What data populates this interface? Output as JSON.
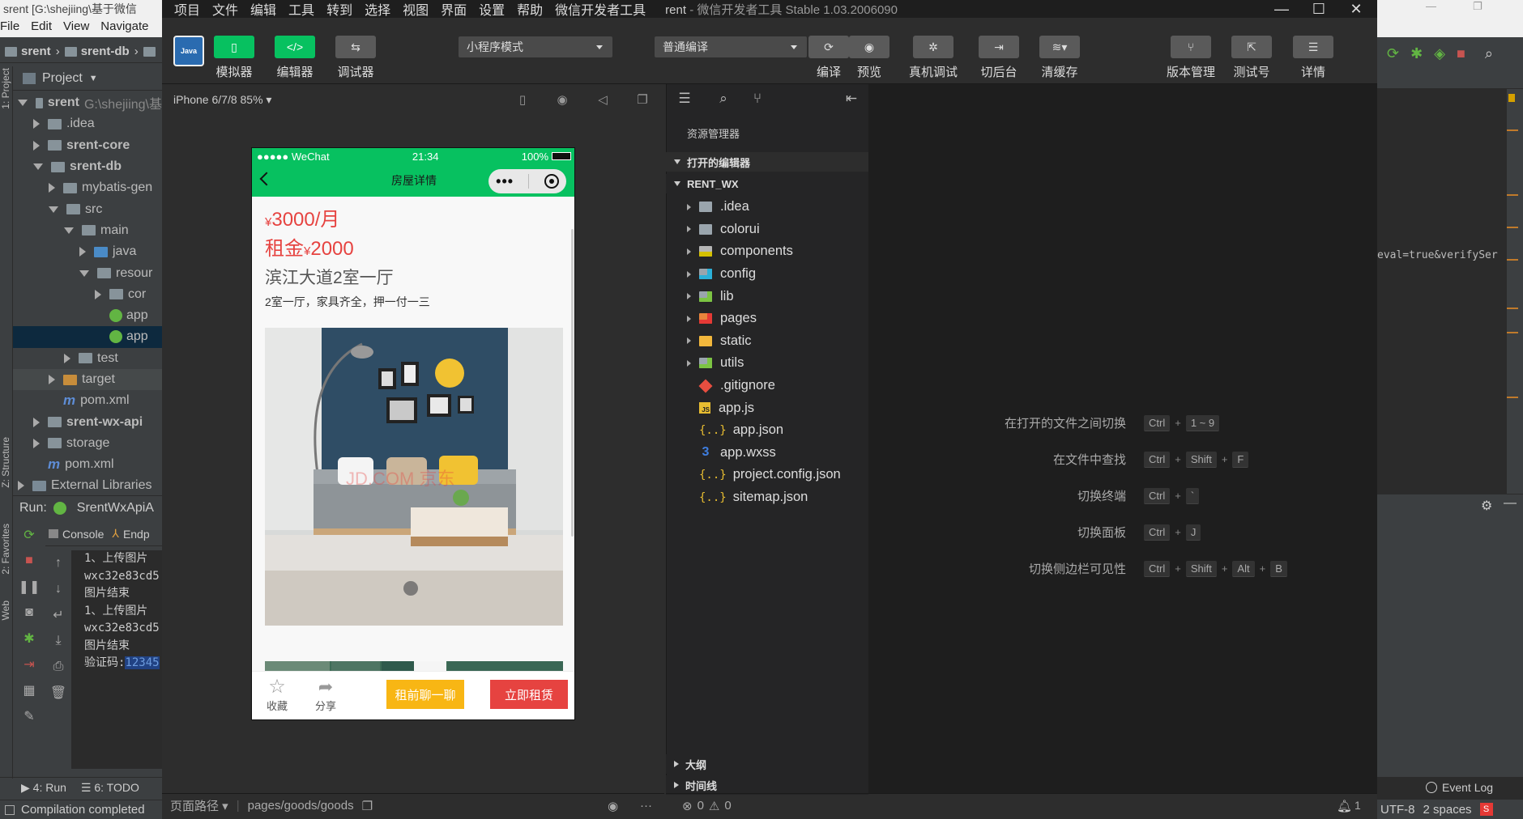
{
  "ij": {
    "title": "srent [G:\\shejiing\\基于微信",
    "menu": [
      "File",
      "Edit",
      "View",
      "Navigate"
    ],
    "breadcrumb": [
      "srent",
      "srent-db"
    ],
    "project_label": "Project",
    "sidebar_tab_project": "1: Project",
    "sidebar_tab_structure": "Z: Structure",
    "sidebar_tab_favorites": "2: Favorites",
    "sidebar_tab_web": "Web",
    "tree": [
      {
        "label": "srent",
        "suffix": "G:\\shejiing\\基",
        "depth": 0,
        "open": true,
        "icon": "folder",
        "bold": true
      },
      {
        "label": ".idea",
        "depth": 1,
        "open": false,
        "icon": "folder"
      },
      {
        "label": "srent-core",
        "depth": 1,
        "open": false,
        "icon": "folder",
        "bold": true
      },
      {
        "label": "srent-db",
        "depth": 1,
        "open": true,
        "icon": "folder",
        "bold": true
      },
      {
        "label": "mybatis-gen",
        "depth": 2,
        "open": false,
        "icon": "folder"
      },
      {
        "label": "src",
        "depth": 2,
        "open": true,
        "icon": "folder"
      },
      {
        "label": "main",
        "depth": 3,
        "open": true,
        "icon": "folder"
      },
      {
        "label": "java",
        "depth": 4,
        "open": false,
        "icon": "folder-blue"
      },
      {
        "label": "resour",
        "depth": 4,
        "open": true,
        "icon": "folder"
      },
      {
        "label": "cor",
        "depth": 5,
        "open": false,
        "icon": "folder"
      },
      {
        "label": "app",
        "depth": 5,
        "icon": "leaf"
      },
      {
        "label": "app",
        "depth": 5,
        "icon": "leaf",
        "selected": true
      },
      {
        "label": "test",
        "depth": 3,
        "open": false,
        "icon": "folder"
      },
      {
        "label": "target",
        "depth": 2,
        "open": false,
        "icon": "folder-orange",
        "highlight": true
      },
      {
        "label": "pom.xml",
        "depth": 2,
        "icon": "m"
      },
      {
        "label": "srent-wx-api",
        "depth": 1,
        "open": false,
        "icon": "folder",
        "bold": true
      },
      {
        "label": "storage",
        "depth": 1,
        "open": false,
        "icon": "folder"
      },
      {
        "label": "pom.xml",
        "depth": 1,
        "icon": "m"
      },
      {
        "label": "External Libraries",
        "depth": 0,
        "open": false,
        "icon": "lib"
      }
    ],
    "run_label": "Run:",
    "run_config": "SrentWxApiA",
    "run_tabs": [
      "Console",
      "Endp"
    ],
    "console": [
      "1、上传图片",
      "wxc32e83cd5",
      "图片结束",
      "1、上传图片",
      "wxc32e83cd5",
      "图片结束"
    ],
    "console_code_label": "验证码:",
    "console_code_value": "12345",
    "bottom_tabs": [
      "4: Run",
      "6: TODO"
    ],
    "status": "Compilation completed",
    "right_code": "eval=true&verifySer",
    "event_log": "Event Log",
    "encoding": "UTF-8",
    "indent": "2 spaces"
  },
  "wx": {
    "menu": [
      "项目",
      "文件",
      "编辑",
      "工具",
      "转到",
      "选择",
      "视图",
      "界面",
      "设置",
      "帮助",
      "微信开发者工具"
    ],
    "title_project": "rent",
    "title_rest": "- 微信开发者工具 Stable 1.03.2006090",
    "toolbar": {
      "simulator": "模拟器",
      "editor": "编辑器",
      "debugger": "调试器",
      "mode_select": "小程序模式",
      "compile_select": "普通编译",
      "compile": "编译",
      "preview": "预览",
      "real_debug": "真机调试",
      "background": "切后台",
      "clear_cache": "清缓存",
      "version": "版本管理",
      "test_account": "测试号",
      "details": "详情"
    },
    "device": "iPhone 6/7/8 85%",
    "phone": {
      "carrier": "●●●●● WeChat",
      "time": "21:34",
      "battery": "100%",
      "nav_title": "房屋详情",
      "price_symbol": "¥",
      "price": "3000/月",
      "deposit_label": "租金",
      "deposit_symbol": "¥",
      "deposit": "2000",
      "title": "滨江大道2室一厅",
      "desc": "2室一厅，家具齐全，押一付一三",
      "watermark": "JD.COM 京东",
      "fav": "收藏",
      "share": "分享",
      "chat": "租前聊一聊",
      "rent": "立即租赁"
    },
    "page_path_label": "页面路径",
    "page_path": "pages/goods/goods",
    "explorer": {
      "title": "资源管理器",
      "open_editors": "打开的编辑器",
      "project": "RENT_WX",
      "files": [
        {
          "name": ".idea",
          "type": "folder",
          "icon": "gray"
        },
        {
          "name": "colorui",
          "type": "folder",
          "icon": "gray"
        },
        {
          "name": "components",
          "type": "folder",
          "icon": "comp"
        },
        {
          "name": "config",
          "type": "folder",
          "icon": "cfg"
        },
        {
          "name": "lib",
          "type": "folder",
          "icon": "lib"
        },
        {
          "name": "pages",
          "type": "folder",
          "icon": "pages"
        },
        {
          "name": "static",
          "type": "folder",
          "icon": "static"
        },
        {
          "name": "utils",
          "type": "folder",
          "icon": "utils"
        },
        {
          "name": ".gitignore",
          "type": "file",
          "icon": "git"
        },
        {
          "name": "app.js",
          "type": "file",
          "icon": "js"
        },
        {
          "name": "app.json",
          "type": "file",
          "icon": "json"
        },
        {
          "name": "app.wxss",
          "type": "file",
          "icon": "css"
        },
        {
          "name": "project.config.json",
          "type": "file",
          "icon": "json"
        },
        {
          "name": "sitemap.json",
          "type": "file",
          "icon": "json"
        }
      ],
      "outline": "大纲",
      "timeline": "时间线",
      "errors": "0",
      "warnings": "0"
    },
    "shortcuts": [
      {
        "label": "在打开的文件之间切换",
        "keys": [
          "Ctrl",
          "1 ~ 9"
        ]
      },
      {
        "label": "在文件中查找",
        "keys": [
          "Ctrl",
          "Shift",
          "F"
        ]
      },
      {
        "label": "切换终端",
        "keys": [
          "Ctrl",
          "`"
        ]
      },
      {
        "label": "切换面板",
        "keys": [
          "Ctrl",
          "J"
        ]
      },
      {
        "label": "切换侧边栏可见性",
        "keys": [
          "Ctrl",
          "Shift",
          "Alt",
          "B"
        ]
      }
    ]
  }
}
